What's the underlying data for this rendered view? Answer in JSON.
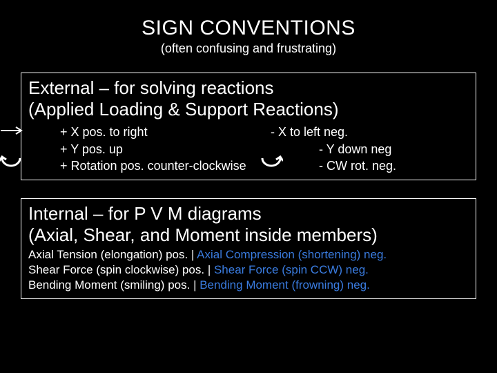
{
  "title": "SIGN CONVENTIONS",
  "subtitle": "(often confusing and frustrating)",
  "external": {
    "heading_line1": "External – for solving reactions",
    "heading_line2": "(Applied Loading & Support Reactions)",
    "rules": {
      "r1_left": "+ X pos. to right",
      "r1_right": "-  X to left neg.",
      "r2_left": "+ Y pos. up",
      "r2_right": "-  Y down neg",
      "r3_left": "+ Rotation pos. counter-clockwise",
      "r3_right": "-  CW rot. neg."
    }
  },
  "internal": {
    "heading_line1": "Internal – for P V M diagrams",
    "heading_line2": "(Axial, Shear, and Moment inside members)",
    "lines": [
      {
        "pos": "Axial Tension (elongation) pos.",
        "neg": "Axial Compression  (shortening) neg."
      },
      {
        "pos": "Shear Force (spin clockwise) pos.",
        "neg": "Shear Force (spin CCW) neg."
      },
      {
        "pos": "Bending Moment (smiling) pos.",
        "neg": "Bending Moment (frowning) neg."
      }
    ]
  },
  "colors": {
    "neg_text": "#3a7ce0"
  }
}
